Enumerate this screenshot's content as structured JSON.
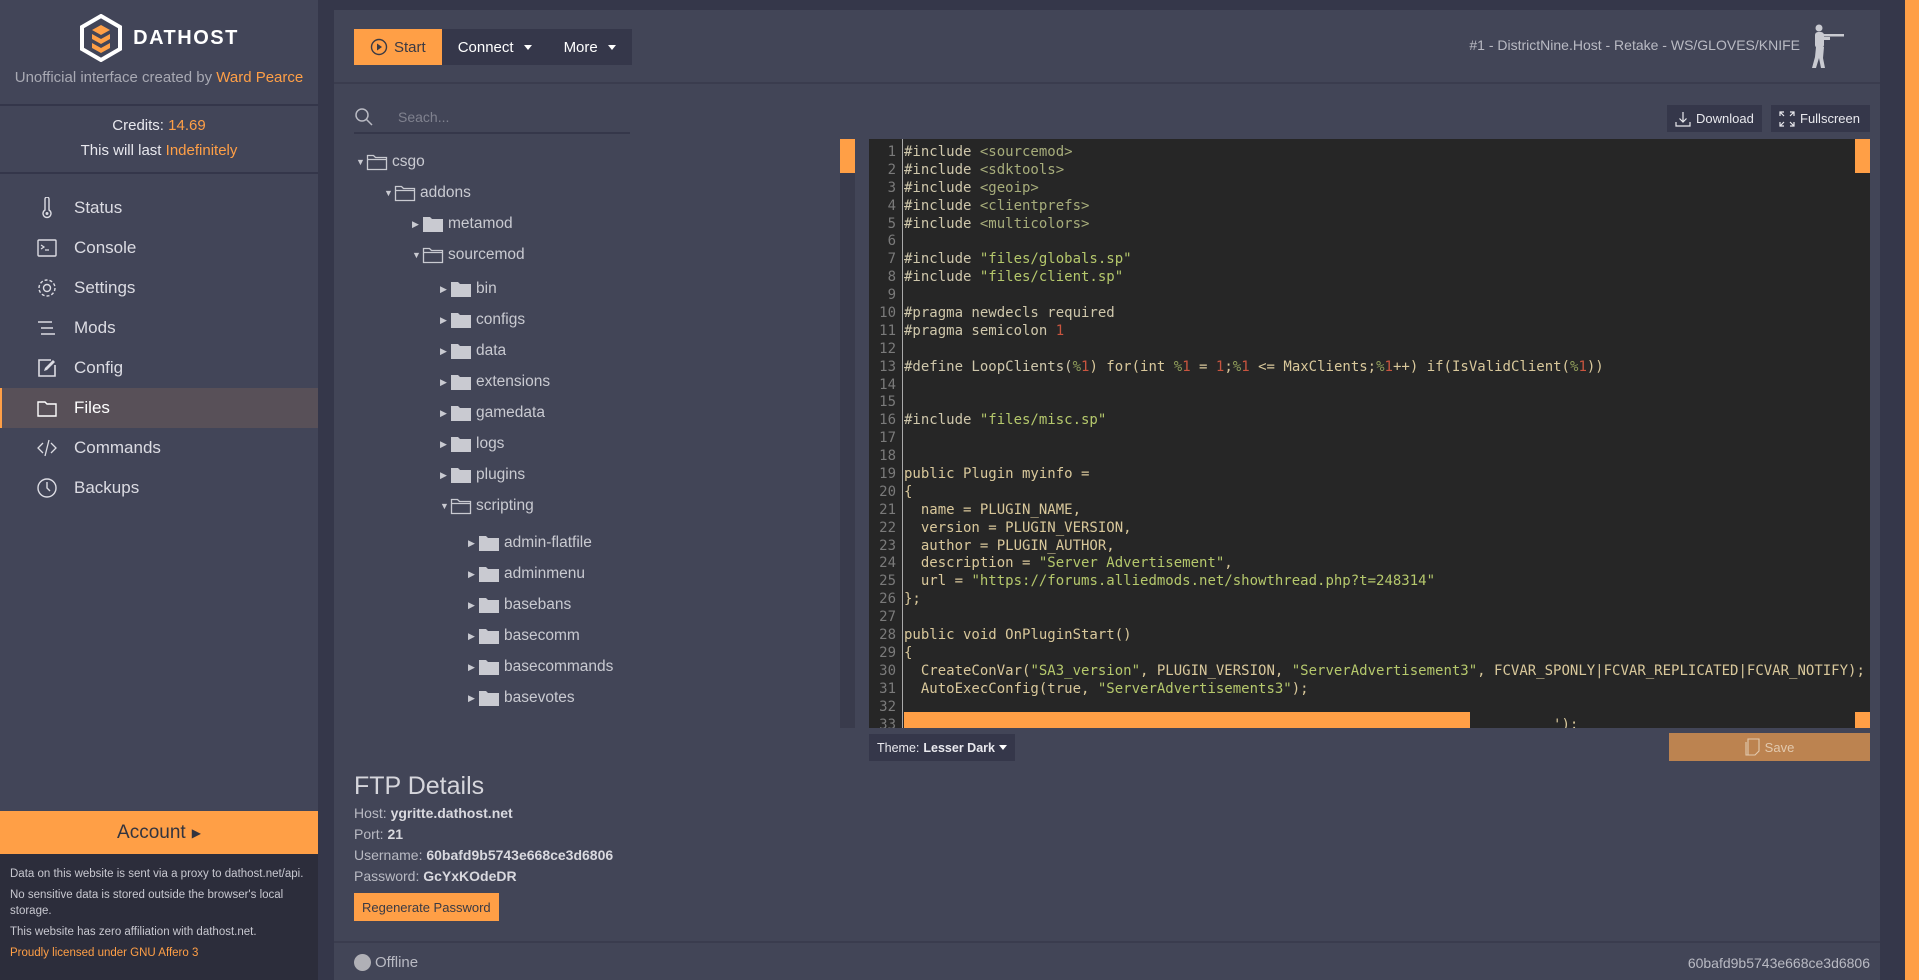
{
  "sidebar": {
    "brand": "DATHOST",
    "subtitle_prefix": "Unofficial interface created by",
    "author": "Ward Pearce",
    "credits_label": "Credits:",
    "credits_value": "14.69",
    "last_label": "This will last",
    "last_value": "Indefinitely",
    "nav": [
      {
        "label": "Status",
        "icon": "thermometer"
      },
      {
        "label": "Console",
        "icon": "terminal"
      },
      {
        "label": "Settings",
        "icon": "gear"
      },
      {
        "label": "Mods",
        "icon": "list"
      },
      {
        "label": "Config",
        "icon": "edit"
      },
      {
        "label": "Files",
        "icon": "folder",
        "active": true
      },
      {
        "label": "Commands",
        "icon": "code"
      },
      {
        "label": "Backups",
        "icon": "clock"
      }
    ],
    "account_label": "Account",
    "footer": [
      "Data on this website is sent via a proxy to dathost.net/api.",
      "No sensitive data is stored outside the browser's local storage.",
      "This website has zero affiliation with dathost.net."
    ],
    "license": "Proudly licensed under GNU Affero 3"
  },
  "header": {
    "start": "Start",
    "connect": "Connect",
    "more": "More",
    "server_name": "#1 - DistrictNine.Host - Retake - WS/GLOVES/KNIFE"
  },
  "files": {
    "search_placeholder": "Seach...",
    "tree": [
      {
        "name": "csgo",
        "depth": 0,
        "open": true
      },
      {
        "name": "addons",
        "depth": 1,
        "open": true
      },
      {
        "name": "metamod",
        "depth": 2,
        "open": false
      },
      {
        "name": "sourcemod",
        "depth": 2,
        "open": true
      },
      {
        "name": "bin",
        "depth": 3,
        "open": false
      },
      {
        "name": "configs",
        "depth": 3,
        "open": false
      },
      {
        "name": "data",
        "depth": 3,
        "open": false
      },
      {
        "name": "extensions",
        "depth": 3,
        "open": false
      },
      {
        "name": "gamedata",
        "depth": 3,
        "open": false
      },
      {
        "name": "logs",
        "depth": 3,
        "open": false
      },
      {
        "name": "plugins",
        "depth": 3,
        "open": false
      },
      {
        "name": "scripting",
        "depth": 3,
        "open": true
      },
      {
        "name": "admin-flatfile",
        "depth": 4,
        "open": false
      },
      {
        "name": "adminmenu",
        "depth": 4,
        "open": false
      },
      {
        "name": "basebans",
        "depth": 4,
        "open": false
      },
      {
        "name": "basecomm",
        "depth": 4,
        "open": false
      },
      {
        "name": "basecommands",
        "depth": 4,
        "open": false
      },
      {
        "name": "basevotes",
        "depth": 4,
        "open": false
      }
    ]
  },
  "editor": {
    "download": "Download",
    "fullscreen": "Fullscreen",
    "theme_label": "Theme:",
    "theme_value": "Lesser Dark",
    "save": "Save",
    "code": [
      [
        [
          "meta",
          "#include "
        ],
        [
          "inc",
          "<sourcemod>"
        ]
      ],
      [
        [
          "meta",
          "#include "
        ],
        [
          "inc",
          "<sdktools>"
        ]
      ],
      [
        [
          "meta",
          "#include "
        ],
        [
          "inc",
          "<geoip>"
        ]
      ],
      [
        [
          "meta",
          "#include "
        ],
        [
          "inc",
          "<clientprefs>"
        ]
      ],
      [
        [
          "meta",
          "#include "
        ],
        [
          "inc",
          "<multicolors>"
        ]
      ],
      [],
      [
        [
          "meta",
          "#include "
        ],
        [
          "str",
          "\"files/globals.sp\""
        ]
      ],
      [
        [
          "meta",
          "#include "
        ],
        [
          "str",
          "\"files/client.sp\""
        ]
      ],
      [],
      [
        [
          "meta",
          "#pragma newdecls required"
        ]
      ],
      [
        [
          "meta",
          "#pragma semicolon "
        ],
        [
          "num",
          "1"
        ]
      ],
      [],
      [
        [
          "meta",
          "#define LoopClients("
        ],
        [
          "var",
          "%"
        ],
        [
          "num",
          "1"
        ],
        [
          "op",
          ") for(int "
        ],
        [
          "var",
          "%"
        ],
        [
          "num",
          "1"
        ],
        [
          "op",
          " = "
        ],
        [
          "num",
          "1"
        ],
        [
          "op",
          ";"
        ],
        [
          "var",
          "%"
        ],
        [
          "num",
          "1"
        ],
        [
          "op",
          " <= MaxClients;"
        ],
        [
          "var",
          "%"
        ],
        [
          "num",
          "1"
        ],
        [
          "op",
          "++) if(IsValidClient("
        ],
        [
          "var",
          "%"
        ],
        [
          "num",
          "1"
        ],
        [
          "op",
          "))"
        ]
      ],
      [],
      [],
      [
        [
          "meta",
          "#include "
        ],
        [
          "str",
          "\"files/misc.sp\""
        ]
      ],
      [],
      [],
      [
        [
          "op",
          "public Plugin myinfo ="
        ]
      ],
      [
        [
          "op",
          "{"
        ]
      ],
      [
        [
          "op",
          "  name = PLUGIN_NAME,"
        ]
      ],
      [
        [
          "op",
          "  version = PLUGIN_VERSION,"
        ]
      ],
      [
        [
          "op",
          "  author = PLUGIN_AUTHOR,"
        ]
      ],
      [
        [
          "op",
          "  description = "
        ],
        [
          "str",
          "\"Server Advertisement\""
        ],
        [
          "op",
          ","
        ]
      ],
      [
        [
          "op",
          "  url = "
        ],
        [
          "str",
          "\"https://forums.alliedmods.net/showthread.php?t=248314\""
        ]
      ],
      [
        [
          "op",
          "};"
        ]
      ],
      [],
      [
        [
          "op",
          "public void OnPluginStart()"
        ]
      ],
      [
        [
          "op",
          "{"
        ]
      ],
      [
        [
          "op",
          "  CreateConVar("
        ],
        [
          "str",
          "\"SA3_version\""
        ],
        [
          "op",
          ", PLUGIN_VERSION, "
        ],
        [
          "str",
          "\"ServerAdvertisement3\""
        ],
        [
          "op",
          ", FCVAR_SPONLY|FCVAR_REPLICATED|FCVAR_NOTIFY);"
        ]
      ],
      [
        [
          "op",
          "  AutoExecConfig(true, "
        ],
        [
          "str",
          "\"ServerAdvertisements3\""
        ],
        [
          "op",
          ");"
        ]
      ],
      [],
      [
        [
          "op",
          "                                                                             ');"
        ]
      ]
    ]
  },
  "ftp": {
    "title": "FTP Details",
    "host_label": "Host:",
    "host": "ygritte.dathost.net",
    "port_label": "Port:",
    "port": "21",
    "username_label": "Username:",
    "username": "60bafd9b5743e668ce3d6806",
    "password_label": "Password:",
    "password": "GcYxKOdeDR",
    "regenerate": "Regenerate Password"
  },
  "footer": {
    "status": "Offline",
    "server_id": "60bafd9b5743e668ce3d6806"
  },
  "colors": {
    "accent": "#ff9f46",
    "sidebar": "#424558",
    "editor_bg": "#262626",
    "save": "#bc8350"
  }
}
